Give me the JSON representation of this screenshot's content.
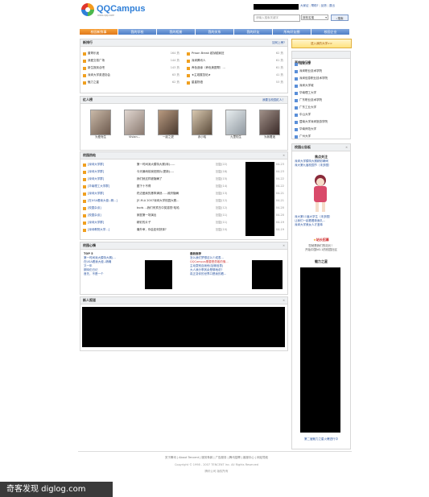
{
  "header": {
    "logo_text": "QQCampus",
    "logo_sub": "xiao.qq.com",
    "top_links": [
      "大家证",
      "帮助?",
      "反馈",
      "退出"
    ],
    "search_placeholder": "请输入搜索关键字",
    "search_select": "按校名搜",
    "search_button": "搜索"
  },
  "nav": [
    "校园新鲜事",
    "我的学校",
    "我的相册",
    "我的关系",
    "我的好友",
    "所有好友圈",
    "校园企业"
  ],
  "ranking": {
    "title": "新排行",
    "more": "如何上榜?",
    "left": [
      {
        "name": "董哥乐迷",
        "count": "164 热"
      },
      {
        "name": "我爱交易广场",
        "count": "144 热"
      },
      {
        "name": "新生报到合吧",
        "count": "143 热"
      },
      {
        "name": "深圳大学英语协会",
        "count": "63 热"
      },
      {
        "name": "魅力之星",
        "count": "62 热"
      }
    ],
    "right": [
      {
        "name": "Prison Break 越狱越疯狂",
        "count": "62 热"
      },
      {
        "name": "深圳腾讯人",
        "count": "61 热"
      },
      {
        "name": "养色造缘（养色美图帮）...",
        "count": "61 热"
      },
      {
        "name": "★主观展览帖★",
        "count": "41 热"
      },
      {
        "name": "星星物语",
        "count": "53 热"
      }
    ]
  },
  "popular": {
    "title": "红人榜",
    "more": "我要当校园红人！",
    "people": [
      "为爱而生",
      "Vivian...",
      "一起之夏",
      "赤小哈",
      "九里知生",
      "为我着迷"
    ]
  },
  "hot_threads": {
    "title": "校园热帖",
    "rows": [
      {
        "school": "[深圳大学群]",
        "topic": "第一时间深大模特大赛(转)-----",
        "author": "回复(22)",
        "date": "04-23"
      },
      {
        "school": "[深圳大学群]",
        "topic": "今天暴雨前我拍照片(更新)----",
        "author": "回复(18)",
        "date": "04-23"
      },
      {
        "school": "[深圳大学群]",
        "topic": "我们就这样被隐瞒了",
        "author": "回复(15)",
        "date": "04-22"
      },
      {
        "school": "[华南理工大学群]",
        "topic": "图下十不得",
        "author": "回复(14)",
        "date": "04-22"
      },
      {
        "school": "[深圳大学群]",
        "topic": "终边爱疯的愚笨满然......政府隐瞒",
        "author": "回复(13)",
        "date": "04-21"
      },
      {
        "school": "[在USA看我大傻--精...]",
        "topic": "[E.M.A 2007深圳大学校园大赛...",
        "author": "回复(12)",
        "date": "04-21"
      },
      {
        "school": "[校园杂谈]",
        "topic": "buds ...我们来宾去中奖感觉!哈哈",
        "author": "回复(12)",
        "date": "04-20"
      },
      {
        "school": "[校园杂谈]",
        "topic": "家庭第一场演出",
        "author": "回复(11)",
        "date": "04-20"
      },
      {
        "school": "[深圳大学群]",
        "topic": "精彩的片子",
        "author": "回复(11)",
        "date": "04-19"
      },
      {
        "school": "[深圳教院大学...]",
        "topic": "痛外审，你会如何抉择?",
        "author": "回复(10)",
        "date": "04-19"
      }
    ]
  },
  "mood": {
    "title": "校园心情",
    "top_label": "TOP 5",
    "top": [
      "第一时间深大模特大赛(...",
      "在USA看我大傻--精确",
      "又一年",
      "期待仍日记",
      "首先，不是一个"
    ],
    "new_label": "最新推荐",
    "new": [
      "怎么我们梦想这么少成表...",
      "QQCampus需要是勇敢的情...",
      "主动耍别自我他(加微信表)",
      "大人我分享其余是哪地说?",
      "真正变你的世界口是我的看..."
    ]
  },
  "recent": {
    "title": "新人报道"
  },
  "school_rank": {
    "button": "进入我的大学>>",
    "title": "高校排行榜",
    "schools": [
      "深圳大学",
      "深圳职业技术学院",
      "深圳信息职业技术学院",
      "深圳大学城",
      "华南理工大学",
      "广东职业技术学院",
      "广东工业大学",
      "中山大学",
      "暨南大学深圳旅游学院",
      "华南师范大学",
      "广州大学"
    ]
  },
  "notice": {
    "title": "校园公告板",
    "focus_title": "焦点关注",
    "focus_lines": [
      "深圳大学模特大赛精彩瞬间",
      "深大第九届校园节（未多图）",
      "深大..."
    ],
    "links": [
      "深大第11届大学生（未多图）",
      "让我们一起看看新面孔...",
      "深圳大学美女人才荟萃"
    ],
    "promo_title": "站长招募",
    "promo_text": [
      "您就是我们的站长！",
      "开始中国NO.1的校园社区"
    ],
    "star_title": "魅力之星",
    "star_footer": "第二届魅力之星火爆进行中"
  },
  "footer": {
    "links": [
      "关于腾讯",
      "About Tencent",
      "服务条款",
      "广告服务",
      "腾讯招聘",
      "客服中心",
      "网站导航"
    ],
    "copyright": "Copyright © 1998 - 2007 TENCENT Inc. All Rights Reserved",
    "company": "腾讯公司 版权所有"
  },
  "watermark": "奇客发现 diglog.com"
}
